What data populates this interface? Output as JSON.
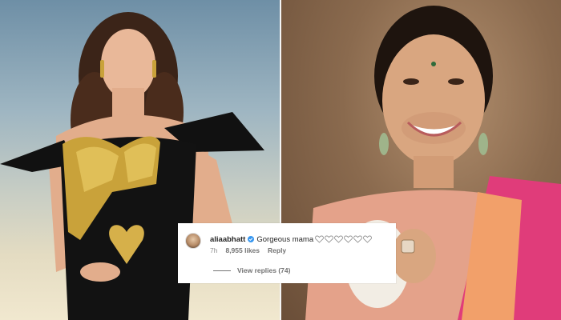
{
  "comment": {
    "username": "aliaabhatt",
    "verified_icon": "verified-badge-icon",
    "text": "Gorgeous mama",
    "hearts": [
      "heart-outline-icon",
      "heart-outline-icon",
      "heart-outline-icon",
      "heart-outline-icon",
      "heart-outline-icon",
      "heart-outline-icon"
    ],
    "time": "7h",
    "likes": "8,955 likes",
    "reply_label": "Reply",
    "view_replies": "View replies (74)"
  },
  "colors": {
    "card_bg": "#ffffff",
    "text_primary": "#262626",
    "text_secondary": "#737373",
    "verified_blue": "#3897f0"
  }
}
